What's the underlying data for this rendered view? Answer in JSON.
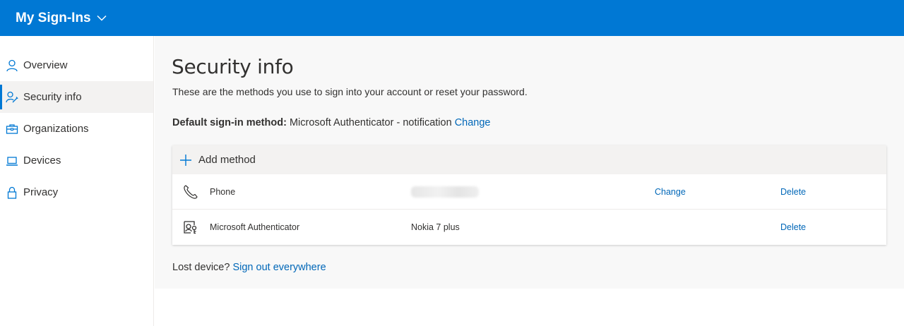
{
  "header": {
    "app_title": "My Sign-Ins",
    "chevron_icon": "chevron-down-icon"
  },
  "sidebar": {
    "items": [
      {
        "label": "Overview",
        "icon": "person-icon",
        "active": false
      },
      {
        "label": "Security info",
        "icon": "security-info-icon",
        "active": true
      },
      {
        "label": "Organizations",
        "icon": "briefcase-icon",
        "active": false
      },
      {
        "label": "Devices",
        "icon": "laptop-icon",
        "active": false
      },
      {
        "label": "Privacy",
        "icon": "lock-icon",
        "active": false
      }
    ]
  },
  "main": {
    "title": "Security info",
    "subtitle": "These are the methods you use to sign into your account or reset your password.",
    "default_method": {
      "label": "Default sign-in method:",
      "value": "Microsoft Authenticator - notification",
      "change_label": "Change"
    },
    "add_method_label": "Add method",
    "methods": [
      {
        "name": "Phone",
        "icon": "phone-icon",
        "detail": "",
        "detail_redacted": true,
        "change_label": "Change",
        "delete_label": "Delete"
      },
      {
        "name": "Microsoft Authenticator",
        "icon": "authenticator-icon",
        "detail": "Nokia 7 plus",
        "detail_redacted": false,
        "change_label": "",
        "delete_label": "Delete"
      }
    ],
    "lost_device": {
      "text": "Lost device?",
      "link": "Sign out everywhere"
    }
  },
  "colors": {
    "brand": "#0078d4",
    "link": "#0067b8",
    "active_bg": "#f3f2f1",
    "content_bg": "#f8f8f8"
  }
}
